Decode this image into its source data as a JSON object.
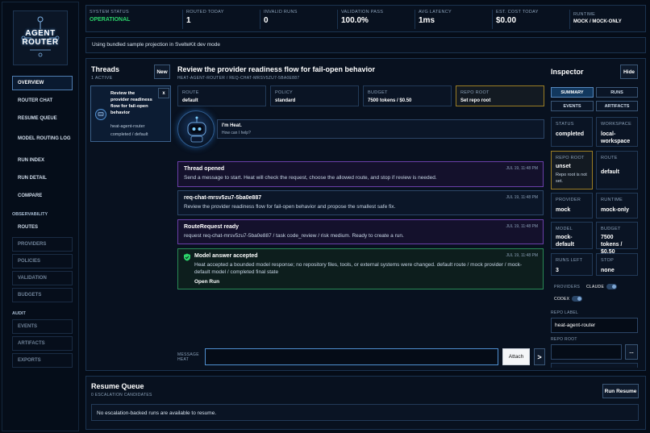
{
  "logo": {
    "line1": "AGENT",
    "line2": "ROUTER"
  },
  "nav": {
    "items": [
      {
        "label": "OVERVIEW"
      },
      {
        "label": "ROUTER CHAT"
      },
      {
        "label": "RESUME QUEUE"
      },
      {
        "label": "MODEL ROUTING LOG"
      },
      {
        "label": "RUN INDEX"
      },
      {
        "label": "RUN DETAIL"
      },
      {
        "label": "COMPARE"
      }
    ],
    "observability_heading": "OBSERVABILITY",
    "observability": [
      {
        "label": "ROUTES"
      },
      {
        "label": "PROVIDERS"
      },
      {
        "label": "POLICIES"
      },
      {
        "label": "VALIDATION"
      },
      {
        "label": "BUDGETS"
      }
    ],
    "audit_heading": "AUDIT",
    "audit": [
      {
        "label": "EVENTS"
      },
      {
        "label": "ARTIFACTS"
      },
      {
        "label": "EXPORTS"
      }
    ]
  },
  "stats": [
    {
      "label": "SYSTEM STATUS",
      "value": "OPERATIONAL"
    },
    {
      "label": "ROUTED TODAY",
      "value": "1"
    },
    {
      "label": "INVALID RUNS",
      "value": "0"
    },
    {
      "label": "VALIDATION PASS",
      "value": "100.0%"
    },
    {
      "label": "AVG LATENCY",
      "value": "1ms"
    },
    {
      "label": "EST. COST TODAY",
      "value": "$0.00"
    },
    {
      "label": "RUNTIME",
      "value": "MOCK / MOCK-ONLY"
    }
  ],
  "notice": "Using bundled sample projection in SvelteKit dev mode",
  "threads": {
    "title": "Threads",
    "count": "1 ACTIVE",
    "new_label": "New",
    "item": {
      "title": "Review the provider readiness flow for fail-open behavior",
      "repo": "heat-agent-router",
      "status": "completed / default",
      "close": "x"
    }
  },
  "chat": {
    "title": "Review the provider readiness flow for fail-open behavior",
    "subtitle": "HEAT-AGENT-ROUTER / REQ-CHAT-MRSV5ZU7-5BA0E887",
    "meta": [
      {
        "label": "ROUTE",
        "value": "default"
      },
      {
        "label": "POLICY",
        "value": "standard"
      },
      {
        "label": "BUDGET",
        "value": "7500 tokens / $0.50"
      },
      {
        "label": "REPO ROOT",
        "value": "Set repo root"
      }
    ],
    "greeting": {
      "title": "I'm Heat.",
      "sub": "How can I help?"
    },
    "messages": [
      {
        "title": "Thread opened",
        "body": "Send a message to start. Heat will check the request, choose the allowed route, and stop if review is needed.",
        "ts": "JUL 19, 11:48 PM"
      },
      {
        "title": "req-chat-mrsv5zu7-5ba0e887",
        "body": "Review the provider readiness flow for fail-open behavior and propose the smallest safe fix.",
        "ts": "JUL 19, 11:48 PM"
      },
      {
        "title": "RouteRequest ready",
        "body": "request req-chat-mrsv5zu7-5ba0e887 / task code_review / risk medium. Ready to create a run.",
        "ts": "JUL 19, 11:48 PM"
      },
      {
        "title": "Model answer accepted",
        "body": "Heat accepted a bounded model response; no repository files, tools, or external systems were changed. default route / mock provider / mock-default model / completed final state",
        "ts": "JUL 19, 11:48 PM",
        "action": "Open Run"
      }
    ],
    "composer": {
      "label1": "MESSAGE",
      "label2": "HEAT",
      "value": "",
      "attach": "Attach",
      "send": ">"
    }
  },
  "inspector": {
    "title": "Inspector",
    "hide": "Hide",
    "tabs": [
      "SUMMARY",
      "RUNS",
      "EVENTS",
      "ARTIFACTS"
    ],
    "cells": [
      {
        "label": "STATUS",
        "value": "completed"
      },
      {
        "label": "WORKSPACE",
        "value": "local-workspace"
      },
      {
        "label": "REPO ROOT",
        "value": "unset",
        "note": "Repo root is not set."
      },
      {
        "label": "ROUTE",
        "value": "default"
      },
      {
        "label": "PROVIDER",
        "value": "mock"
      },
      {
        "label": "RUNTIME",
        "value": "mock-only"
      },
      {
        "label": "MODEL",
        "value": "mock-default"
      },
      {
        "label": "BUDGET",
        "value": "7500 tokens / $0.50"
      },
      {
        "label": "RUNS LEFT",
        "value": "3"
      },
      {
        "label": "STOP",
        "value": "none"
      }
    ],
    "providers_label": "PROVIDERS",
    "claude_label": "CLAUDE",
    "codex_label": "CODEX",
    "repo_label_heading": "REPO LABEL",
    "repo_label_value": "heat-agent-router",
    "repo_root_heading": "REPO ROOT",
    "repo_root_value": "",
    "browse": "..."
  },
  "resume": {
    "title": "Resume Queue",
    "count": "0 ESCALATION CANDIDATES",
    "button": "Run Resume",
    "empty": "No escalation-backed runs are available to resume."
  },
  "colors": {
    "accent": "#4f8fd0",
    "success": "#2bd46a",
    "warning": "#c9a227",
    "purple": "#8a4fd0",
    "green_border": "#2a8a55"
  }
}
